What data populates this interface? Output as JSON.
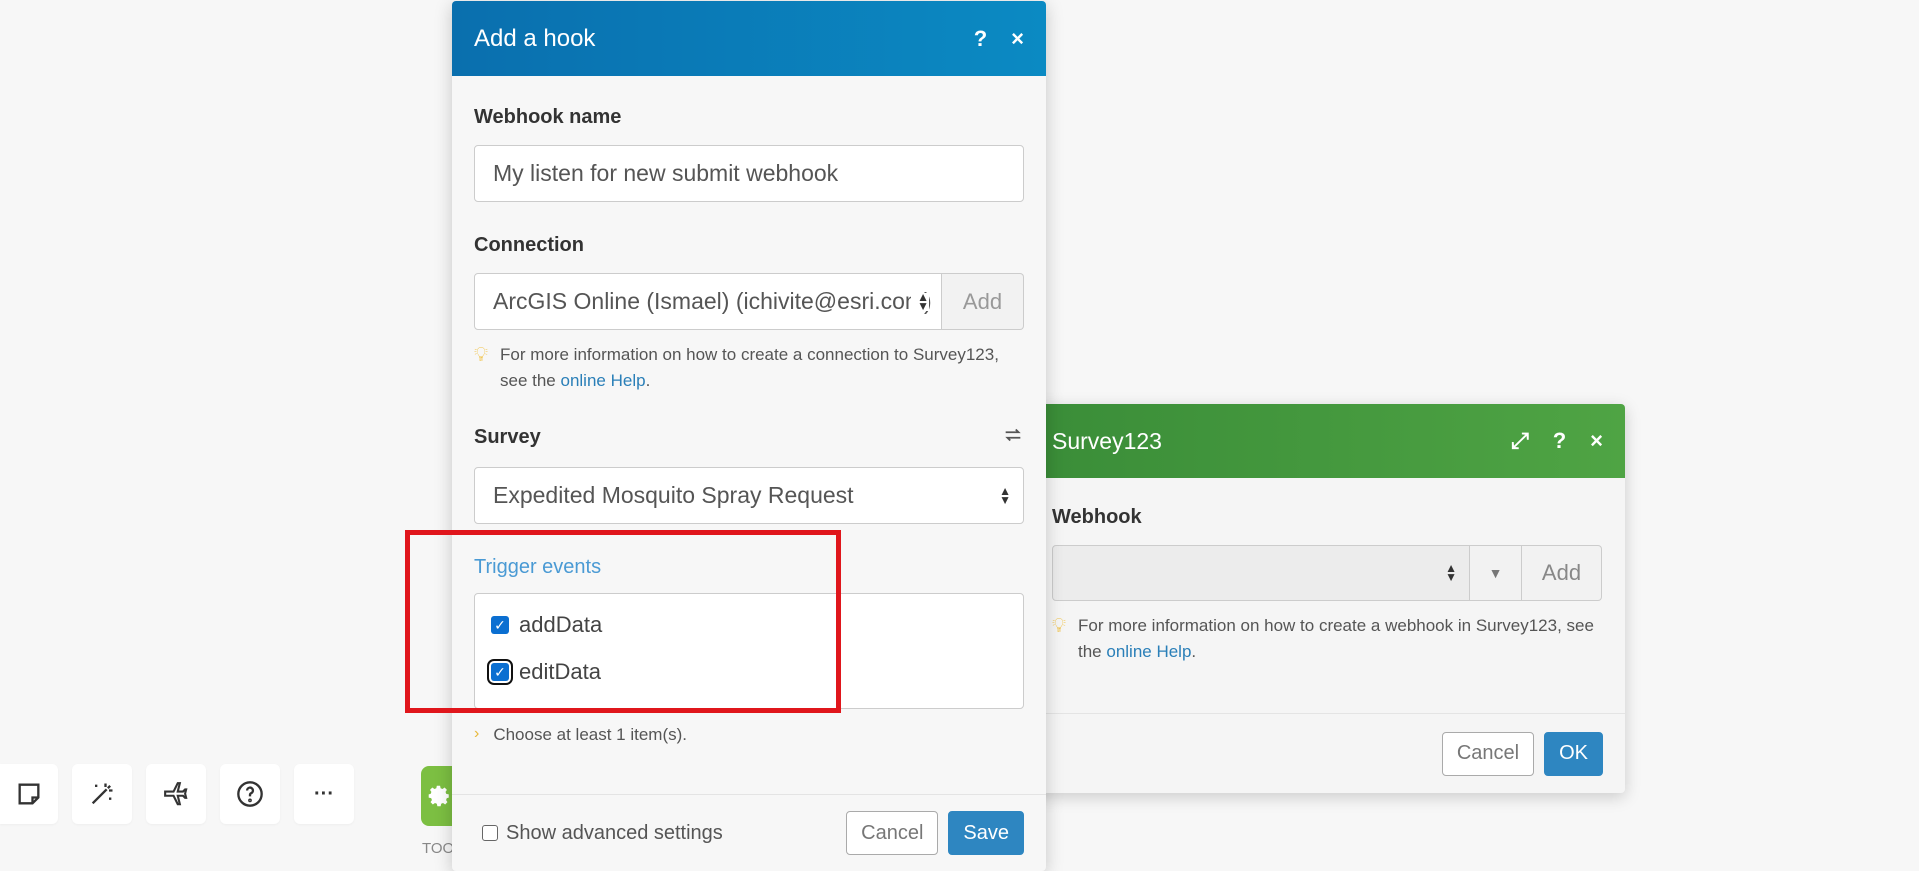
{
  "toolbar": {
    "items": [
      {
        "icon": "note-icon"
      },
      {
        "icon": "magic-wand-icon"
      },
      {
        "icon": "airplane-icon"
      },
      {
        "icon": "help-circle-icon"
      },
      {
        "icon": "more-icon",
        "label": "···"
      }
    ],
    "tools_label": "TOO",
    "under_label": "..... ......"
  },
  "survey_panel": {
    "title": "Survey123",
    "webhook_label": "Webhook",
    "webhook_value": "",
    "add_label": "Add",
    "hint_text": "For more information on how to create a webhook in Survey123, see the ",
    "hint_link": "online Help",
    "hint_end": ".",
    "cancel_label": "Cancel",
    "ok_label": "OK",
    "header_color": "#43993d"
  },
  "hook_dialog": {
    "title": "Add a hook",
    "webhook_name_label": "Webhook name",
    "webhook_name_value": "My listen for new submit webhook",
    "connection_label": "Connection",
    "connection_value": "ArcGIS Online (Ismael) (ichivite@esri.com)",
    "connection_add": "Add",
    "connection_hint": "For more information on how to create a connection to Survey123, see the ",
    "connection_hint_link": "online Help",
    "connection_hint_end": ".",
    "survey_label": "Survey",
    "survey_value": "Expedited Mosquito Spray Request",
    "trigger_label": "Trigger events",
    "events": [
      {
        "label": "addData",
        "checked": true
      },
      {
        "label": "editData",
        "checked": true
      }
    ],
    "choose_hint": "Choose at least 1 item(s).",
    "advanced_label": "Show advanced settings",
    "cancel_label": "Cancel",
    "save_label": "Save",
    "header_color": "#0a7cb8"
  }
}
